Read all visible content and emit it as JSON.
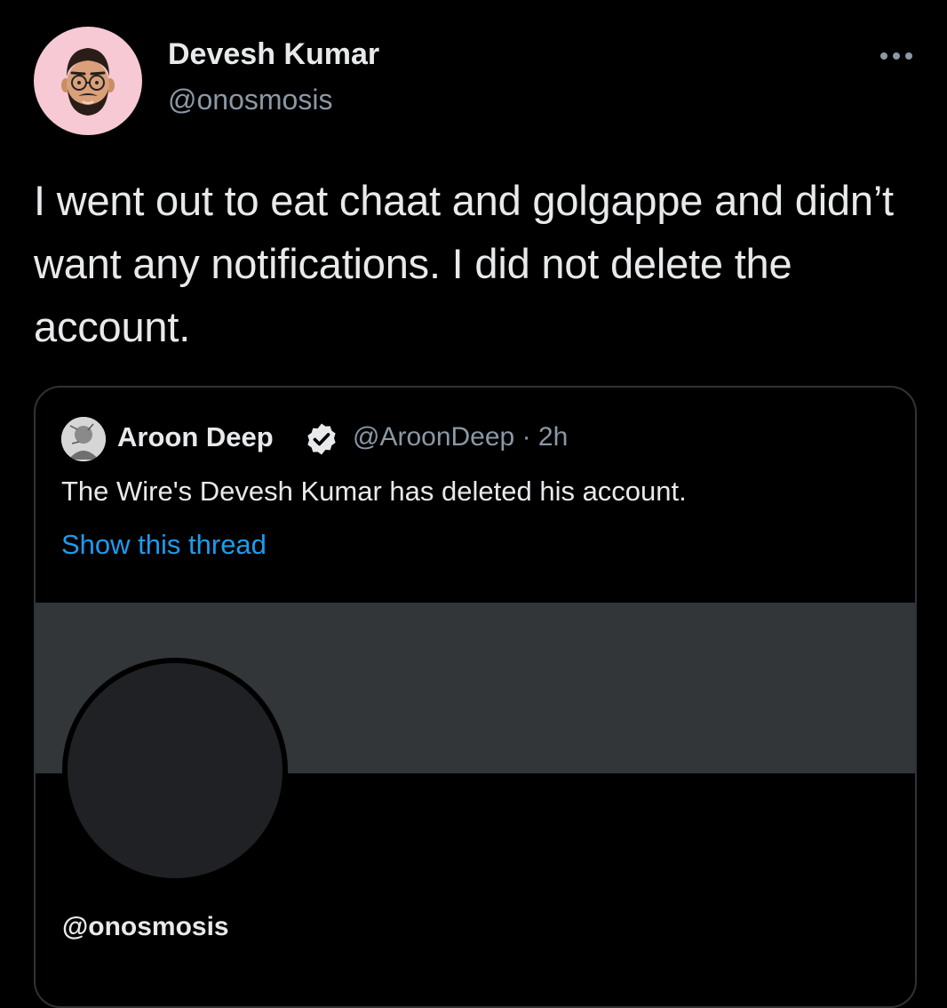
{
  "tweet": {
    "author_name": "Devesh Kumar",
    "author_handle": "@onosmosis",
    "avatar_icon": "memoji-avatar",
    "more_icon": "more-options-icon",
    "text": "I went out to eat chaat and golgappe and didn’t want any notifications. I did not delete the account."
  },
  "quoted_tweet": {
    "author_name": "Aroon Deep",
    "verified_icon": "verified-badge-icon",
    "author_handle": "@AroonDeep",
    "time": "· 2h",
    "text": "The Wire's Devesh Kumar has deleted his account.",
    "show_thread_label": "Show this thread",
    "profile_card_handle": "@onosmosis"
  },
  "colors": {
    "background": "#000000",
    "text_primary": "#e7e9ea",
    "text_secondary": "#8b98a5",
    "link": "#1d9bf0",
    "banner": "#333639",
    "avatar_bg": "#f6c9d4"
  }
}
